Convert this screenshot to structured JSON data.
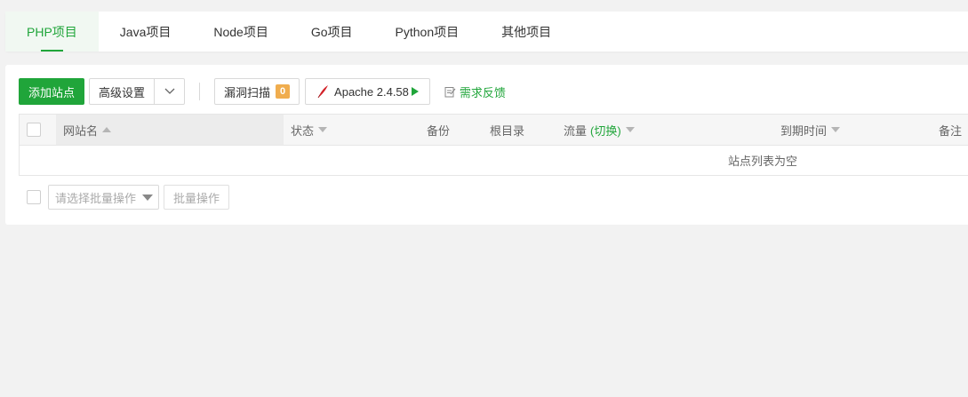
{
  "tabs": [
    {
      "label": "PHP项目",
      "active": true
    },
    {
      "label": "Java项目",
      "active": false
    },
    {
      "label": "Node项目",
      "active": false
    },
    {
      "label": "Go项目",
      "active": false
    },
    {
      "label": "Python项目",
      "active": false
    },
    {
      "label": "其他项目",
      "active": false
    }
  ],
  "toolbar": {
    "add_site": "添加站点",
    "advanced": "高级设置",
    "vuln_scan": "漏洞扫描",
    "vuln_count": "0",
    "server": "Apache 2.4.58",
    "feedback": "需求反馈"
  },
  "table": {
    "columns": {
      "site_name": "网站名",
      "status": "状态",
      "backup": "备份",
      "root": "根目录",
      "traffic": "流量",
      "traffic_switch": "(切换)",
      "expire": "到期时间",
      "note": "备注"
    },
    "empty_text": "站点列表为空"
  },
  "batch": {
    "select_placeholder": "请选择批量操作",
    "button": "批量操作"
  },
  "colors": {
    "accent": "#20a53a",
    "badge": "#f0ad4e"
  }
}
